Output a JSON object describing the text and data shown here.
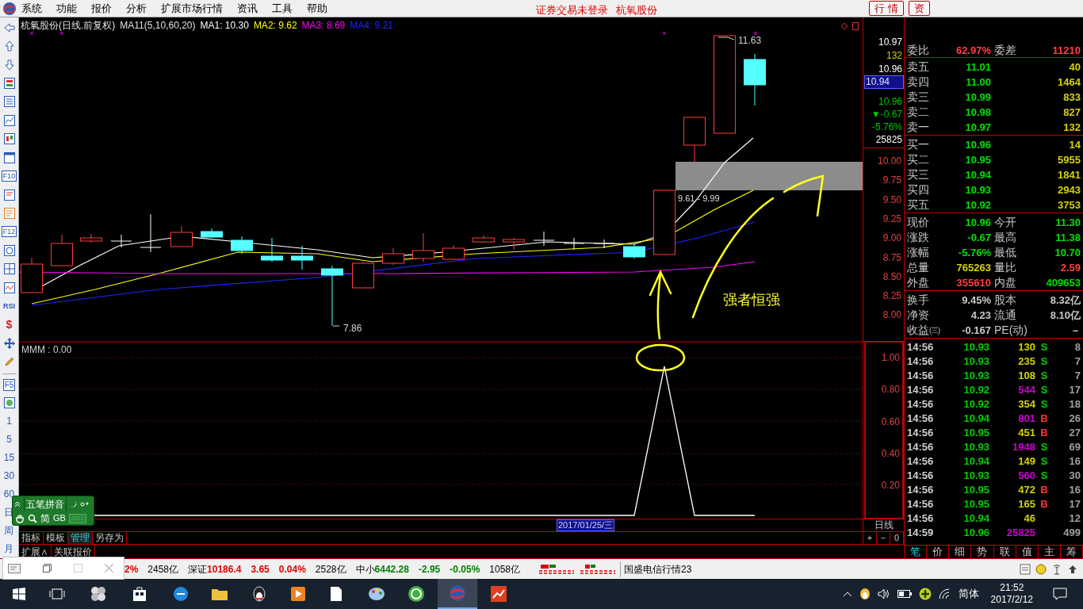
{
  "menu_bar": {
    "items": [
      "系统",
      "功能",
      "报价",
      "分析",
      "扩展市场行情",
      "资讯",
      "工具",
      "帮助"
    ],
    "notice": "证券交易未登录",
    "stock_name": "杭氧股份",
    "buttons": [
      "行 情",
      "资"
    ]
  },
  "left_toolbar": {
    "key_labels": [
      "F10",
      "F12",
      "RSI",
      "$",
      "F5"
    ],
    "periods": [
      "1",
      "5",
      "15",
      "30",
      "60",
      "日",
      "周",
      "月"
    ]
  },
  "chart": {
    "title": "杭氧股份(日线.前复权)",
    "indicator": "MA11(5,10,60,20)",
    "moving_averages": [
      {
        "label": "MA1: 10.30",
        "color": "#ffffff"
      },
      {
        "label": "MA2: 9.62",
        "color": "#ffff00"
      },
      {
        "label": "MA3: 8.69",
        "color": "#ff00ff"
      },
      {
        "label": "MA4: 9.21",
        "color": "#2323ff"
      }
    ],
    "high_label": "11.63",
    "low_label": "7.86",
    "zone_label": "9.61 - 9.99",
    "annotation": "强者恒强",
    "axis_info": [
      {
        "text": "10.97",
        "color": "#ffffff",
        "highlighted": false
      },
      {
        "text": "132",
        "color": "#d4d400",
        "highlighted": false
      },
      {
        "text": "10.96",
        "color": "#ffffff",
        "highlighted": false
      },
      {
        "text": "10.94",
        "highlighted": true
      },
      {
        "text": "10.96",
        "color": "#00c800",
        "highlighted": false
      },
      {
        "text": "▼-0.67",
        "color": "#00c800",
        "highlighted": false
      },
      {
        "text": "-5.76%",
        "color": "#00c800",
        "highlighted": false
      },
      {
        "text": "25825",
        "color": "#ffffff",
        "highlighted": false
      }
    ],
    "yticks": [
      "10.00",
      "9.75",
      "9.50",
      "9.25",
      "9.00",
      "8.75",
      "8.50",
      "8.25",
      "8.00"
    ]
  },
  "indicator_pane": {
    "label": "MMM : 0.00",
    "yticks": [
      "1.00",
      "0.80",
      "0.60",
      "0.40",
      "0.20"
    ]
  },
  "date_label": "2017/01/25/三",
  "period_label": "日线",
  "zoom_buttons": [
    "+",
    "−",
    "0"
  ],
  "bottom_tabs": [
    {
      "label": "指标",
      "selected": false
    },
    {
      "label": "模板",
      "selected": false
    },
    {
      "label": "管理",
      "selected": true
    },
    {
      "label": "另存为",
      "selected": false
    }
  ],
  "extra_tabs": [
    "扩展∧",
    "关联报价"
  ],
  "quote": {
    "ratio": {
      "label": "委比",
      "value": "62.97%",
      "label2": "委差",
      "value2": "11210"
    },
    "asks": [
      {
        "label": "卖五",
        "price": "11.01",
        "volume": "40"
      },
      {
        "label": "卖四",
        "price": "11.00",
        "volume": "1464"
      },
      {
        "label": "卖三",
        "price": "10.99",
        "volume": "833"
      },
      {
        "label": "卖二",
        "price": "10.98",
        "volume": "827"
      },
      {
        "label": "卖一",
        "price": "10.97",
        "volume": "132"
      }
    ],
    "bids": [
      {
        "label": "买一",
        "price": "10.96",
        "volume": "14"
      },
      {
        "label": "买二",
        "price": "10.95",
        "volume": "5955"
      },
      {
        "label": "买三",
        "price": "10.94",
        "volume": "1841"
      },
      {
        "label": "买四",
        "price": "10.93",
        "volume": "2943"
      },
      {
        "label": "买五",
        "price": "10.92",
        "volume": "3753"
      }
    ],
    "stats": [
      [
        {
          "label": "现价",
          "value": "10.96",
          "color": "#00e000"
        },
        {
          "label": "今开",
          "value": "11.30",
          "color": "#00e000"
        }
      ],
      [
        {
          "label": "涨跌",
          "value": "-0.67",
          "color": "#00e000"
        },
        {
          "label": "最高",
          "value": "11.38",
          "color": "#00e000"
        }
      ],
      [
        {
          "label": "涨幅",
          "value": "-5.76%",
          "color": "#00e000"
        },
        {
          "label": "最低",
          "value": "10.70",
          "color": "#00e000"
        }
      ],
      [
        {
          "label": "总量",
          "value": "765263",
          "color": "#d4d400"
        },
        {
          "label": "量比",
          "value": "2.59",
          "color": "#ff4040"
        }
      ],
      [
        {
          "label": "外盘",
          "value": "355610",
          "color": "#ff4040"
        },
        {
          "label": "内盘",
          "value": "409653",
          "color": "#00e000"
        }
      ]
    ],
    "fundamentals": [
      {
        "label": "换手",
        "value": "9.45%",
        "label2": "股本",
        "value2": "8.32亿"
      },
      {
        "label": "净资",
        "value": "4.23",
        "label2": "流通",
        "value2": "8.10亿"
      },
      {
        "label": "收益㈢",
        "value": "-0.167",
        "label2": "PE(动)",
        "value2": "－"
      }
    ],
    "ticks": [
      {
        "time": "14:56",
        "price": "10.93",
        "volume": "130",
        "color": "#d4d400",
        "side": {
          "text": "S",
          "color": "#00d000"
        },
        "count": "8"
      },
      {
        "time": "14:56",
        "price": "10.93",
        "volume": "235",
        "color": "#d4d400",
        "side": {
          "text": "S",
          "color": "#00d000"
        },
        "count": "7"
      },
      {
        "time": "14:56",
        "price": "10.93",
        "volume": "108",
        "color": "#d4d400",
        "side": {
          "text": "S",
          "color": "#00d000"
        },
        "count": "7"
      },
      {
        "time": "14:56",
        "price": "10.92",
        "volume": "544",
        "color": "#d000d0",
        "side": {
          "text": "S",
          "color": "#00d000"
        },
        "count": "17"
      },
      {
        "time": "14:56",
        "price": "10.92",
        "volume": "354",
        "color": "#d4d400",
        "side": {
          "text": "S",
          "color": "#00d000"
        },
        "count": "18"
      },
      {
        "time": "14:56",
        "price": "10.94",
        "volume": "801",
        "color": "#d000d0",
        "side": {
          "text": "B",
          "color": "#ff3030"
        },
        "count": "26"
      },
      {
        "time": "14:56",
        "price": "10.95",
        "volume": "451",
        "color": "#d4d400",
        "side": {
          "text": "B",
          "color": "#ff3030"
        },
        "count": "27"
      },
      {
        "time": "14:56",
        "price": "10.93",
        "volume": "1948",
        "color": "#d000d0",
        "side": {
          "text": "S",
          "color": "#00d000"
        },
        "count": "69"
      },
      {
        "time": "14:56",
        "price": "10.94",
        "volume": "149",
        "color": "#d4d400",
        "side": {
          "text": "S",
          "color": "#00d000"
        },
        "count": "16"
      },
      {
        "time": "14:56",
        "price": "10.93",
        "volume": "560",
        "color": "#d000d0",
        "side": {
          "text": "S",
          "color": "#00d000"
        },
        "count": "30"
      },
      {
        "time": "14:56",
        "price": "10.95",
        "volume": "472",
        "color": "#d4d400",
        "side": {
          "text": "B",
          "color": "#ff3030"
        },
        "count": "16"
      },
      {
        "time": "14:56",
        "price": "10.95",
        "volume": "165",
        "color": "#d4d400",
        "side": {
          "text": "B",
          "color": "#ff3030"
        },
        "count": "17"
      },
      {
        "time": "14:56",
        "price": "10.94",
        "volume": "46",
        "color": "#d4d400",
        "count": "12"
      },
      {
        "time": "14:59",
        "price": "10.96",
        "volume": "25825",
        "color": "#d000d0",
        "count": "499"
      }
    ],
    "tabs": [
      {
        "label": "笔",
        "selected": true
      },
      {
        "label": "价",
        "selected": false
      },
      {
        "label": "细",
        "selected": false
      },
      {
        "label": "势",
        "selected": false
      },
      {
        "label": "联",
        "selected": false
      },
      {
        "label": "值",
        "selected": false
      },
      {
        "label": "主",
        "selected": false
      },
      {
        "label": "筹",
        "selected": false
      }
    ]
  },
  "status_bar": {
    "segments": [
      {
        "percent": "2%",
        "amount": "2458亿",
        "color": "#e00000"
      },
      {
        "name": "深证",
        "value": "10186.4",
        "change": "3.65",
        "percent": "0.04%",
        "amount": "2528亿",
        "color": "#e00000"
      },
      {
        "name": "中小",
        "value": "6442.28",
        "change": "-2.95",
        "percent": "-0.05%",
        "amount": "1058亿",
        "color": "#008000"
      }
    ],
    "ticker": "国盛电信行情23"
  },
  "taskbar": {
    "input_mode": "简体",
    "time": "21:52",
    "date": "2017/2/12"
  },
  "ime": {
    "name": "五笔拼音",
    "mode": "简",
    "charset": "GB"
  }
}
